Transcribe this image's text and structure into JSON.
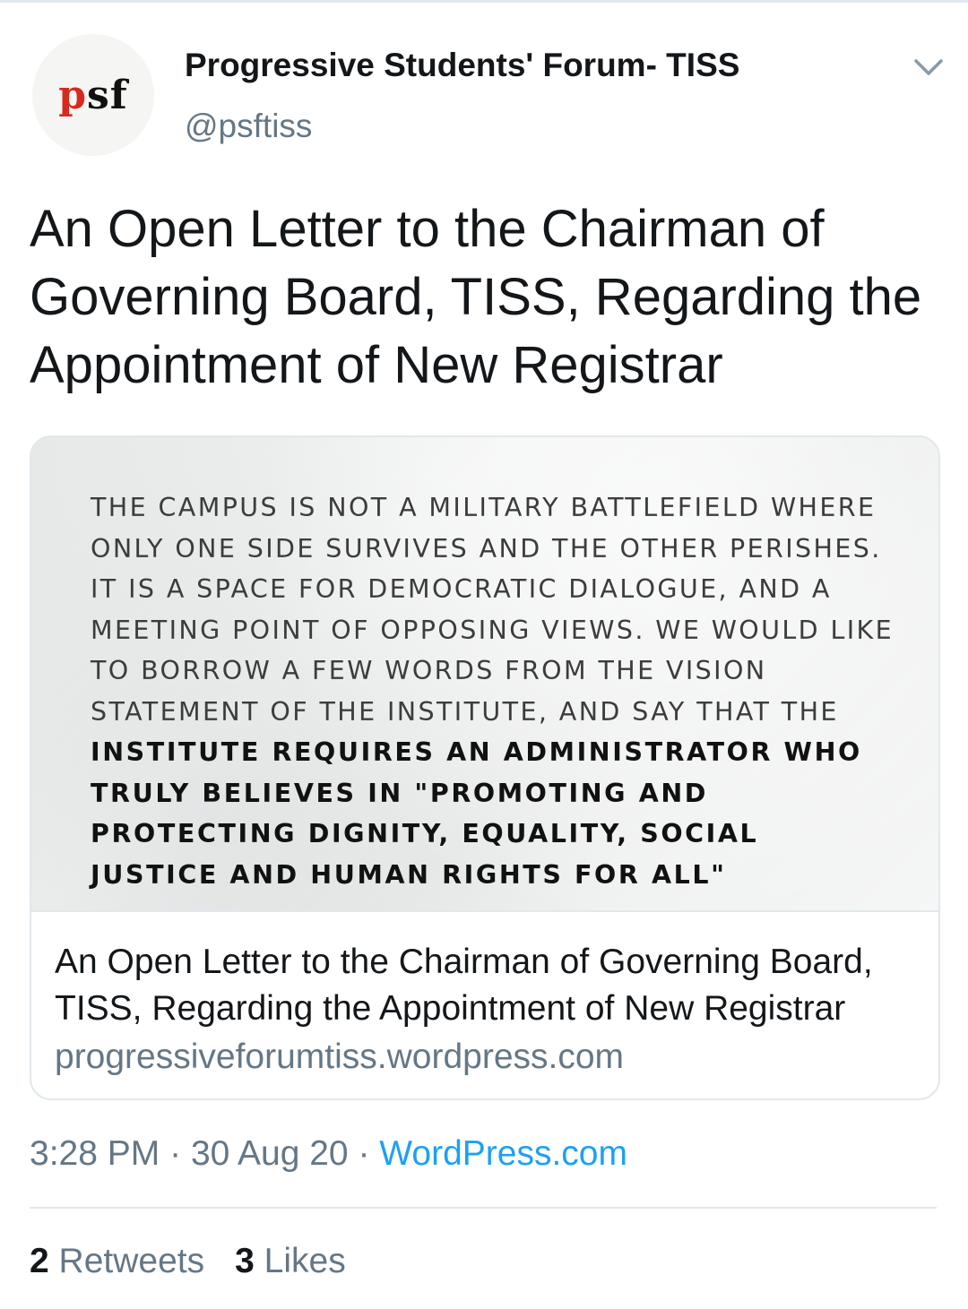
{
  "account": {
    "avatar_text_p": "p",
    "avatar_text_sf": "sf",
    "name": "Progressive Students' Forum- TISS",
    "handle": "@psftiss"
  },
  "tweet": {
    "text": "An Open Letter to the Chairman of Governing Board, TISS, Regarding the Appointment of New Registrar"
  },
  "card": {
    "image_text_normal": "THE CAMPUS IS NOT A MILITARY BATTLEFIELD WHERE ONLY ONE SIDE SURVIVES AND THE OTHER PERISHES. IT IS A SPACE FOR DEMOCRATIC DIALOGUE, AND A MEETING POINT OF OPPOSING VIEWS. WE WOULD LIKE TO BORROW A FEW WORDS FROM THE VISION STATEMENT OF THE INSTITUTE, AND SAY THAT THE ",
    "image_text_bold": "INSTITUTE REQUIRES AN ADMINISTRATOR WHO TRULY BELIEVES IN \"PROMOTING AND PROTECTING DIGNITY, EQUALITY, SOCIAL JUSTICE AND HUMAN RIGHTS FOR ALL\"",
    "title": "An Open Letter to the Chairman of Governing Board, TISS, Regarding the Appointment of New Registrar",
    "domain": "progressiveforumtiss.wordpress.com"
  },
  "meta": {
    "time": "3:28 PM",
    "separator": "·",
    "date": "30 Aug 20",
    "source": "WordPress.com"
  },
  "stats": {
    "retweets_count": "2",
    "retweets_label": "Retweets",
    "likes_count": "3",
    "likes_label": "Likes"
  },
  "icons": {
    "menu": "chevron-down-icon"
  },
  "colors": {
    "link": "#1da1f2",
    "secondary_text": "#657786",
    "logo_red": "#d52b1e"
  }
}
